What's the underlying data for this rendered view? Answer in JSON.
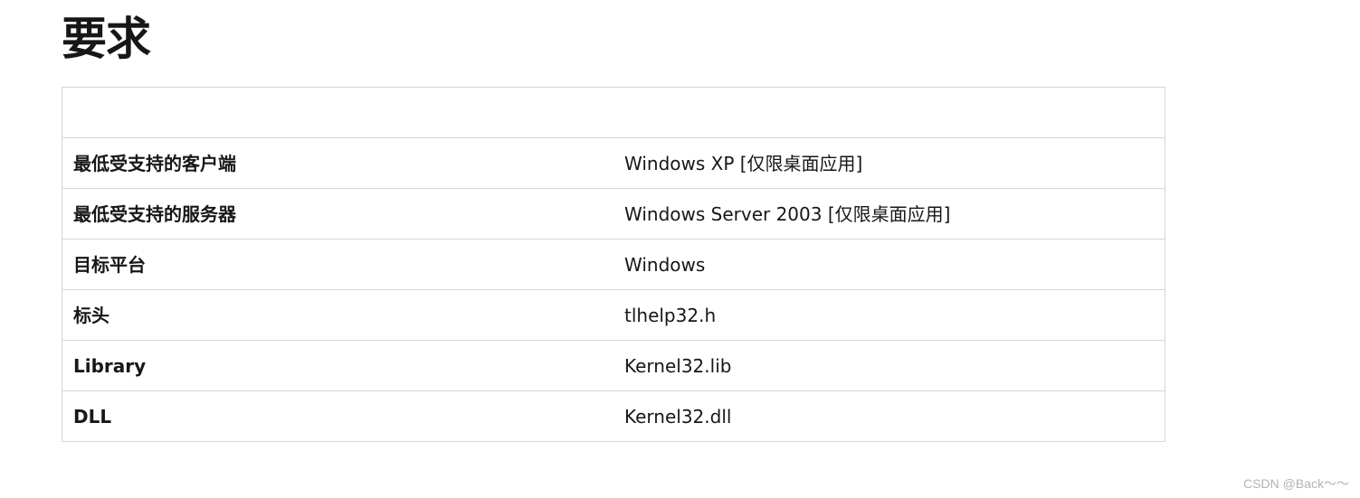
{
  "heading": "要求",
  "table": {
    "rows": [
      {
        "label": "最低受支持的客户端",
        "value": "Windows XP [仅限桌面应用]"
      },
      {
        "label": "最低受支持的服务器",
        "value": "Windows Server 2003 [仅限桌面应用]"
      },
      {
        "label": "目标平台",
        "value": "Windows"
      },
      {
        "label": "标头",
        "value": "tlhelp32.h"
      },
      {
        "label": "Library",
        "value": "Kernel32.lib"
      },
      {
        "label": "DLL",
        "value": "Kernel32.dll"
      }
    ]
  },
  "watermark": "CSDN @Back～～"
}
